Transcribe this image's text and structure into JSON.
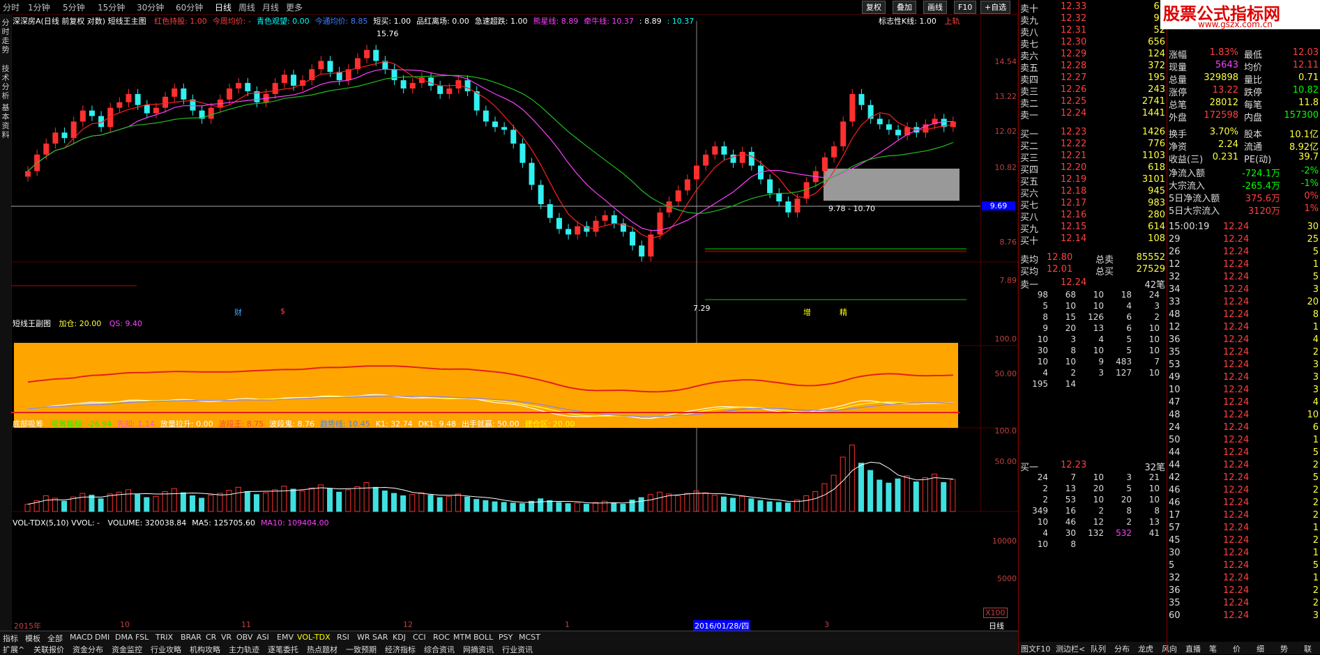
{
  "top_bar": {
    "periods": [
      "分时",
      "1分钟",
      "5分钟",
      "15分钟",
      "30分钟",
      "60分钟",
      "日线",
      "周线",
      "月线",
      "更多"
    ],
    "active": "日线",
    "buttons": [
      "复权",
      "叠加",
      "画线",
      "F10",
      "+自选"
    ]
  },
  "left_strip": [
    "分时走势",
    "技术分析",
    "基本资料"
  ],
  "main_chart": {
    "title": "深深房A(日线 前复权 对数) 短线王主图",
    "indicators": [
      {
        "label": "红色持股: 1.00",
        "color": "#ff4040"
      },
      {
        "label": "今周均价: -",
        "color": "#ff4040"
      },
      {
        "label": "青色观望: 0.00",
        "color": "#00ffff"
      },
      {
        "label": "今通均价: 8.85",
        "color": "#4080ff"
      },
      {
        "label": "短买: 1.00",
        "color": "#ffffff"
      },
      {
        "label": "品红离场: 0.00",
        "color": "#ffffff"
      },
      {
        "label": "急速超跌: 1.00",
        "color": "#ffffff"
      },
      {
        "label": "熊星线: 8.89",
        "color": "#ff40ff"
      },
      {
        "label": "牵牛线: 10.37",
        "color": "#ff40ff"
      },
      {
        "label": ": 8.89",
        "color": "#ffffff"
      },
      {
        "label": ": 10.37",
        "color": "#00ffff"
      }
    ],
    "right_labels": [
      "标志性K线: 1.00",
      "上轨"
    ],
    "y_ticks": [
      14.54,
      13.22,
      12.02,
      10.82,
      9.69,
      8.76,
      7.89
    ],
    "highlight_price": "9.69",
    "high_label": "15.76",
    "low_label": "7.29",
    "band_label": "9.78 - 10.70",
    "markers": [
      "财",
      "$",
      "增",
      "精"
    ]
  },
  "sub1": {
    "title": "短线王副图",
    "values": [
      "加仓: 20.00",
      "QS: 9.40"
    ],
    "y_ticks": [
      "100.0",
      "50.00"
    ]
  },
  "sub2": {
    "title": "底部吸筹",
    "values": [
      {
        "label": "吸筹指标: -26.94",
        "color": "#00ff00"
      },
      {
        "label": "先知: 1.14",
        "color": "#ff40ff"
      },
      {
        "label": "放量拉升: 0.00",
        "color": "#ffffff"
      },
      {
        "label": "波段王: 8.75",
        "color": "#ff4040"
      },
      {
        "label": "波段鬼: 8.76",
        "color": "#ffffff"
      },
      {
        "label": "趋势线: 10.45",
        "color": "#4080ff"
      },
      {
        "label": "K1: 32.74",
        "color": "#ffffff"
      },
      {
        "label": "DK1: 9.48",
        "color": "#ffffff"
      },
      {
        "label": "出手就赢: 50.00",
        "color": "#ffffff"
      },
      {
        "label": "建仓区: 20.00",
        "color": "#ffff00"
      }
    ],
    "y_ticks": [
      "100.0",
      "50.00"
    ]
  },
  "volume": {
    "title": "VOL-TDX(5,10) VVOL: -",
    "values": [
      {
        "label": "VOLUME: 320038.84",
        "color": "#ffffff"
      },
      {
        "label": "MA5: 125705.60",
        "color": "#ffffff"
      },
      {
        "label": "MA10: 109404.00",
        "color": "#ff40ff"
      }
    ],
    "y_ticks": [
      "10000",
      "5000"
    ],
    "unit": "X100"
  },
  "x_axis": {
    "labels": [
      "2015年",
      "10",
      "11",
      "12",
      "1",
      "2016/01/28/四",
      "3"
    ],
    "right_label": "日线"
  },
  "bottom_tabs_row1": [
    "指标",
    "模板",
    "全部",
    "MACD",
    "DMI",
    "DMA",
    "FSL",
    "TRIX",
    "BRAR",
    "CR",
    "VR",
    "OBV",
    "ASI",
    "EMV",
    "VOL-TDX",
    "RSI",
    "WR",
    "SAR",
    "KDJ",
    "CCI",
    "ROC",
    "MTM",
    "BOLL",
    "PSY",
    "MCST"
  ],
  "bottom_tabs_row2": [
    "扩展^",
    "关联报价",
    "资金分布",
    "资金监控",
    "行业攻略",
    "机构攻略",
    "主力轨迹",
    "逐笔委托",
    "热点题材",
    "一致预期",
    "经济指标",
    "综合资讯",
    "网摘资讯",
    "行业资讯"
  ],
  "bottom_right_tabs": [
    "图文F10",
    "测边栏<",
    "队列",
    "分布",
    "龙虎",
    "风向",
    "直播",
    "笔",
    "价",
    "细",
    "势",
    "联",
    "值",
    "主"
  ],
  "order_book": {
    "asks": [
      {
        "label": "卖十",
        "price": "12.33",
        "vol": "65"
      },
      {
        "label": "卖九",
        "price": "12.32",
        "vol": "93"
      },
      {
        "label": "卖八",
        "price": "12.31",
        "vol": "52"
      },
      {
        "label": "卖七",
        "price": "12.30",
        "vol": "656"
      },
      {
        "label": "卖六",
        "price": "12.29",
        "vol": "124"
      },
      {
        "label": "卖五",
        "price": "12.28",
        "vol": "372"
      },
      {
        "label": "卖四",
        "price": "12.27",
        "vol": "195"
      },
      {
        "label": "卖三",
        "price": "12.26",
        "vol": "243"
      },
      {
        "label": "卖二",
        "price": "12.25",
        "vol": "2741"
      },
      {
        "label": "卖一",
        "price": "12.24",
        "vol": "1441"
      }
    ],
    "bids": [
      {
        "label": "买一",
        "price": "12.23",
        "vol": "1426"
      },
      {
        "label": "买二",
        "price": "12.22",
        "vol": "776"
      },
      {
        "label": "买三",
        "price": "12.21",
        "vol": "1103"
      },
      {
        "label": "买四",
        "price": "12.20",
        "vol": "618"
      },
      {
        "label": "买五",
        "price": "12.19",
        "vol": "3101"
      },
      {
        "label": "买六",
        "price": "12.18",
        "vol": "945"
      },
      {
        "label": "买七",
        "price": "12.17",
        "vol": "983"
      },
      {
        "label": "买八",
        "price": "12.16",
        "vol": "280"
      },
      {
        "label": "买九",
        "price": "12.15",
        "vol": "614"
      },
      {
        "label": "买十",
        "price": "12.14",
        "vol": "108"
      }
    ],
    "avg": [
      {
        "label": "卖均",
        "price": "12.80",
        "k": "总卖",
        "v": "85552"
      },
      {
        "label": "买均",
        "price": "12.01",
        "k": "总买",
        "v": "27529"
      }
    ],
    "ask1_head": {
      "label": "卖一",
      "price": "12.24",
      "count": "42笔"
    },
    "ask1_queue": [
      [
        "98",
        "68",
        "10",
        "18",
        "24"
      ],
      [
        "5",
        "10",
        "10",
        "4",
        "3"
      ],
      [
        "8",
        "15",
        "126",
        "6",
        "2"
      ],
      [
        "9",
        "20",
        "13",
        "6",
        "10"
      ],
      [
        "10",
        "3",
        "4",
        "5",
        "10"
      ],
      [
        "30",
        "8",
        "10",
        "5",
        "10"
      ],
      [
        "10",
        "10",
        "9",
        "483",
        "7"
      ],
      [
        "4",
        "2",
        "3",
        "127",
        "10"
      ],
      [
        "195",
        "14",
        "",
        "",
        ""
      ]
    ],
    "bid1_head": {
      "label": "买一",
      "price": "12.23",
      "count": "32笔"
    },
    "bid1_queue": [
      [
        "24",
        "7",
        "10",
        "3",
        "21"
      ],
      [
        "2",
        "13",
        "20",
        "5",
        "10"
      ],
      [
        "2",
        "53",
        "10",
        "20",
        "10"
      ],
      [
        "349",
        "16",
        "2",
        "8",
        "8"
      ],
      [
        "10",
        "46",
        "12",
        "2",
        "13"
      ],
      [
        "4",
        "30",
        "132",
        "532",
        "41"
      ],
      [
        "10",
        "8",
        "",
        "",
        ""
      ]
    ]
  },
  "quote": {
    "rows": [
      {
        "k1": "涨幅",
        "v1": "1.83%",
        "c1": "#ff4040",
        "k2": "最低",
        "v2": "12.03",
        "c2": "#ff4040"
      },
      {
        "k1": "现量",
        "v1": "5643",
        "c1": "#ff40ff",
        "k2": "均价",
        "v2": "12.11",
        "c2": "#ff4040"
      },
      {
        "k1": "总量",
        "v1": "329898",
        "c1": "#ffff40",
        "k2": "量比",
        "v2": "0.71",
        "c2": "#ffff40"
      },
      {
        "k1": "涨停",
        "v1": "13.22",
        "c1": "#ff4040",
        "k2": "跌停",
        "v2": "10.82",
        "c2": "#00ff00"
      },
      {
        "k1": "总笔",
        "v1": "28012",
        "c1": "#ffff40",
        "k2": "每笔",
        "v2": "11.8",
        "c2": "#ffff40"
      },
      {
        "k1": "外盘",
        "v1": "172598",
        "c1": "#ff4040",
        "k2": "内盘",
        "v2": "157300",
        "c2": "#00ff00"
      },
      {
        "k1": "换手",
        "v1": "3.70%",
        "c1": "#ffff40",
        "k2": "股本",
        "v2": "10.1亿",
        "c2": "#ffff40"
      },
      {
        "k1": "净资",
        "v1": "2.24",
        "c1": "#ffff40",
        "k2": "流通",
        "v2": "8.92亿",
        "c2": "#ffff40"
      },
      {
        "k1": "收益(三)",
        "v1": "0.231",
        "c1": "#ffff40",
        "k2": "PE(动)",
        "v2": "39.7",
        "c2": "#ffff40"
      }
    ],
    "flows": [
      {
        "k": "净流入额",
        "v": "-724.1万",
        "p": "-2%",
        "color": "#00ff00"
      },
      {
        "k": "大宗流入",
        "v": "-265.4万",
        "p": "-1%",
        "color": "#00ff00"
      },
      {
        "k": "5日净流入额",
        "v": "375.6万",
        "p": "0%",
        "color": "#ff4040"
      },
      {
        "k": "5日大宗流入",
        "v": "3120万",
        "p": "1%",
        "color": "#ff4040"
      }
    ],
    "ticks": [
      {
        "t": "15:00:19",
        "p": "12.24",
        "v": "30"
      },
      {
        "t": "29",
        "p": "12.24",
        "v": "25"
      },
      {
        "t": "26",
        "p": "12.24",
        "v": "5"
      },
      {
        "t": "12",
        "p": "12.24",
        "v": "1"
      },
      {
        "t": "32",
        "p": "12.24",
        "v": "5"
      },
      {
        "t": "34",
        "p": "12.24",
        "v": "3"
      },
      {
        "t": "33",
        "p": "12.24",
        "v": "20"
      },
      {
        "t": "48",
        "p": "12.24",
        "v": "8"
      },
      {
        "t": "12",
        "p": "12.24",
        "v": "1"
      },
      {
        "t": "36",
        "p": "12.24",
        "v": "4"
      },
      {
        "t": "35",
        "p": "12.24",
        "v": "2"
      },
      {
        "t": "53",
        "p": "12.24",
        "v": "3"
      },
      {
        "t": "49",
        "p": "12.24",
        "v": "3"
      },
      {
        "t": "10",
        "p": "12.24",
        "v": "3"
      },
      {
        "t": "47",
        "p": "12.24",
        "v": "4"
      },
      {
        "t": "48",
        "p": "12.24",
        "v": "10"
      },
      {
        "t": "24",
        "p": "12.24",
        "v": "6"
      },
      {
        "t": "50",
        "p": "12.24",
        "v": "1"
      },
      {
        "t": "44",
        "p": "12.24",
        "v": "5"
      },
      {
        "t": "44",
        "p": "12.24",
        "v": "2"
      },
      {
        "t": "42",
        "p": "12.24",
        "v": "5"
      },
      {
        "t": "46",
        "p": "12.24",
        "v": "2"
      },
      {
        "t": "46",
        "p": "12.24",
        "v": "2"
      },
      {
        "t": "17",
        "p": "12.24",
        "v": "2"
      },
      {
        "t": "57",
        "p": "12.24",
        "v": "1"
      },
      {
        "t": "45",
        "p": "12.24",
        "v": "2"
      },
      {
        "t": "30",
        "p": "12.24",
        "v": "1"
      },
      {
        "t": "5",
        "p": "12.24",
        "v": "5"
      },
      {
        "t": "32",
        "p": "12.24",
        "v": "1"
      },
      {
        "t": "36",
        "p": "12.24",
        "v": "2"
      },
      {
        "t": "35",
        "p": "12.24",
        "v": "2"
      },
      {
        "t": "60",
        "p": "12.24",
        "v": "3"
      }
    ]
  },
  "watermark": {
    "line1": "股票公式指标网",
    "line2": "www.gszx.com.cn"
  },
  "candles": {
    "closes": [
      10.6,
      11.2,
      11.6,
      12.0,
      11.8,
      12.4,
      12.8,
      12.6,
      12.2,
      12.9,
      13.1,
      13.4,
      13.0,
      12.7,
      12.9,
      13.3,
      13.6,
      13.2,
      12.8,
      12.5,
      12.9,
      13.2,
      13.6,
      13.8,
      13.5,
      13.1,
      13.4,
      13.8,
      14.1,
      13.7,
      13.9,
      14.3,
      14.6,
      14.2,
      13.9,
      14.3,
      14.7,
      15.0,
      14.6,
      14.3,
      13.9,
      13.6,
      13.8,
      14.0,
      13.7,
      13.4,
      13.6,
      13.9,
      13.5,
      12.8,
      12.4,
      12.2,
      12.1,
      11.6,
      10.9,
      10.1,
      9.4,
      8.9,
      8.5,
      8.3,
      8.6,
      8.4,
      8.8,
      9.0,
      8.7,
      8.4,
      7.9,
      7.5,
      8.3,
      9.1,
      9.5,
      9.9,
      10.3,
      10.8,
      11.2,
      11.5,
      11.2,
      10.9,
      11.3,
      10.8,
      10.3,
      9.8,
      9.5,
      9.1,
      9.6,
      10.2,
      10.6,
      11.1,
      11.5,
      12.4,
      13.4,
      13.0,
      12.5,
      12.3,
      12.1,
      11.9,
      12.2,
      12.0,
      12.3,
      12.5,
      12.2,
      12.4
    ],
    "vols": [
      1200,
      1800,
      2600,
      2200,
      1700,
      2400,
      3000,
      2700,
      2100,
      2900,
      3200,
      3600,
      2800,
      2300,
      2500,
      3300,
      3800,
      3100,
      2600,
      2200,
      2700,
      3000,
      3500,
      4000,
      3300,
      2800,
      3100,
      3600,
      4200,
      3700,
      3400,
      3900,
      4400,
      3800,
      3200,
      3600,
      4100,
      4800,
      4000,
      3400,
      3000,
      2600,
      2800,
      3100,
      2700,
      2300,
      2500,
      2900,
      2400,
      2000,
      1800,
      1600,
      1500,
      1400,
      1300,
      1700,
      2100,
      1800,
      1500,
      1300,
      1400,
      1200,
      1500,
      1700,
      1400,
      1200,
      1900,
      2300,
      2800,
      3200,
      2900,
      2600,
      3000,
      3400,
      3100,
      2700,
      2400,
      2200,
      2500,
      2100,
      1800,
      1600,
      1500,
      1400,
      1900,
      2600,
      3300,
      4600,
      6000,
      9000,
      11000,
      8000,
      6800,
      5200,
      4700,
      5400,
      5900,
      4900,
      5600,
      6200,
      4800,
      5300
    ]
  }
}
